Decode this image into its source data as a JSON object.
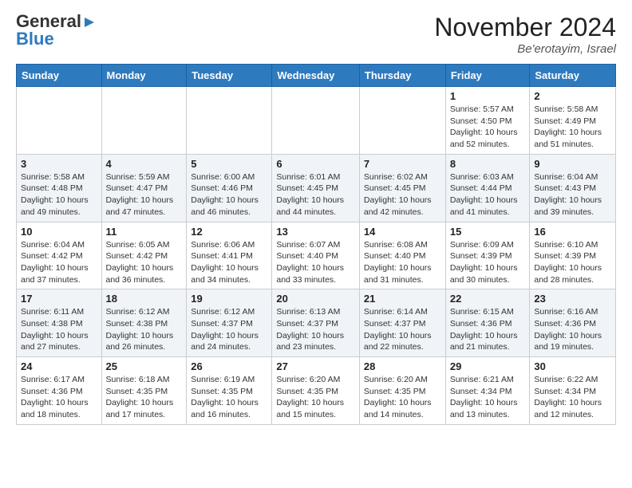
{
  "header": {
    "logo_general": "General",
    "logo_blue": "Blue",
    "month_title": "November 2024",
    "location": "Be'erotayim, Israel"
  },
  "weekdays": [
    "Sunday",
    "Monday",
    "Tuesday",
    "Wednesday",
    "Thursday",
    "Friday",
    "Saturday"
  ],
  "weeks": [
    [
      {
        "day": "",
        "info": ""
      },
      {
        "day": "",
        "info": ""
      },
      {
        "day": "",
        "info": ""
      },
      {
        "day": "",
        "info": ""
      },
      {
        "day": "",
        "info": ""
      },
      {
        "day": "1",
        "info": "Sunrise: 5:57 AM\nSunset: 4:50 PM\nDaylight: 10 hours\nand 52 minutes."
      },
      {
        "day": "2",
        "info": "Sunrise: 5:58 AM\nSunset: 4:49 PM\nDaylight: 10 hours\nand 51 minutes."
      }
    ],
    [
      {
        "day": "3",
        "info": "Sunrise: 5:58 AM\nSunset: 4:48 PM\nDaylight: 10 hours\nand 49 minutes."
      },
      {
        "day": "4",
        "info": "Sunrise: 5:59 AM\nSunset: 4:47 PM\nDaylight: 10 hours\nand 47 minutes."
      },
      {
        "day": "5",
        "info": "Sunrise: 6:00 AM\nSunset: 4:46 PM\nDaylight: 10 hours\nand 46 minutes."
      },
      {
        "day": "6",
        "info": "Sunrise: 6:01 AM\nSunset: 4:45 PM\nDaylight: 10 hours\nand 44 minutes."
      },
      {
        "day": "7",
        "info": "Sunrise: 6:02 AM\nSunset: 4:45 PM\nDaylight: 10 hours\nand 42 minutes."
      },
      {
        "day": "8",
        "info": "Sunrise: 6:03 AM\nSunset: 4:44 PM\nDaylight: 10 hours\nand 41 minutes."
      },
      {
        "day": "9",
        "info": "Sunrise: 6:04 AM\nSunset: 4:43 PM\nDaylight: 10 hours\nand 39 minutes."
      }
    ],
    [
      {
        "day": "10",
        "info": "Sunrise: 6:04 AM\nSunset: 4:42 PM\nDaylight: 10 hours\nand 37 minutes."
      },
      {
        "day": "11",
        "info": "Sunrise: 6:05 AM\nSunset: 4:42 PM\nDaylight: 10 hours\nand 36 minutes."
      },
      {
        "day": "12",
        "info": "Sunrise: 6:06 AM\nSunset: 4:41 PM\nDaylight: 10 hours\nand 34 minutes."
      },
      {
        "day": "13",
        "info": "Sunrise: 6:07 AM\nSunset: 4:40 PM\nDaylight: 10 hours\nand 33 minutes."
      },
      {
        "day": "14",
        "info": "Sunrise: 6:08 AM\nSunset: 4:40 PM\nDaylight: 10 hours\nand 31 minutes."
      },
      {
        "day": "15",
        "info": "Sunrise: 6:09 AM\nSunset: 4:39 PM\nDaylight: 10 hours\nand 30 minutes."
      },
      {
        "day": "16",
        "info": "Sunrise: 6:10 AM\nSunset: 4:39 PM\nDaylight: 10 hours\nand 28 minutes."
      }
    ],
    [
      {
        "day": "17",
        "info": "Sunrise: 6:11 AM\nSunset: 4:38 PM\nDaylight: 10 hours\nand 27 minutes."
      },
      {
        "day": "18",
        "info": "Sunrise: 6:12 AM\nSunset: 4:38 PM\nDaylight: 10 hours\nand 26 minutes."
      },
      {
        "day": "19",
        "info": "Sunrise: 6:12 AM\nSunset: 4:37 PM\nDaylight: 10 hours\nand 24 minutes."
      },
      {
        "day": "20",
        "info": "Sunrise: 6:13 AM\nSunset: 4:37 PM\nDaylight: 10 hours\nand 23 minutes."
      },
      {
        "day": "21",
        "info": "Sunrise: 6:14 AM\nSunset: 4:37 PM\nDaylight: 10 hours\nand 22 minutes."
      },
      {
        "day": "22",
        "info": "Sunrise: 6:15 AM\nSunset: 4:36 PM\nDaylight: 10 hours\nand 21 minutes."
      },
      {
        "day": "23",
        "info": "Sunrise: 6:16 AM\nSunset: 4:36 PM\nDaylight: 10 hours\nand 19 minutes."
      }
    ],
    [
      {
        "day": "24",
        "info": "Sunrise: 6:17 AM\nSunset: 4:36 PM\nDaylight: 10 hours\nand 18 minutes."
      },
      {
        "day": "25",
        "info": "Sunrise: 6:18 AM\nSunset: 4:35 PM\nDaylight: 10 hours\nand 17 minutes."
      },
      {
        "day": "26",
        "info": "Sunrise: 6:19 AM\nSunset: 4:35 PM\nDaylight: 10 hours\nand 16 minutes."
      },
      {
        "day": "27",
        "info": "Sunrise: 6:20 AM\nSunset: 4:35 PM\nDaylight: 10 hours\nand 15 minutes."
      },
      {
        "day": "28",
        "info": "Sunrise: 6:20 AM\nSunset: 4:35 PM\nDaylight: 10 hours\nand 14 minutes."
      },
      {
        "day": "29",
        "info": "Sunrise: 6:21 AM\nSunset: 4:34 PM\nDaylight: 10 hours\nand 13 minutes."
      },
      {
        "day": "30",
        "info": "Sunrise: 6:22 AM\nSunset: 4:34 PM\nDaylight: 10 hours\nand 12 minutes."
      }
    ]
  ]
}
